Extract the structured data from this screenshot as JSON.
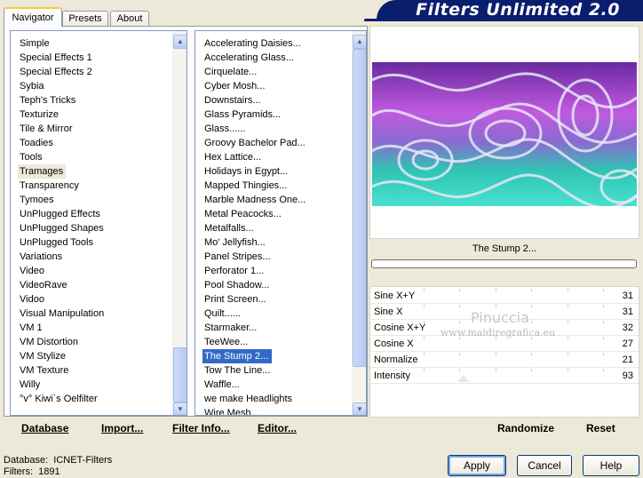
{
  "brand": {
    "title": "Filters Unlimited 2.0"
  },
  "tabs": [
    "Navigator",
    "Presets",
    "About"
  ],
  "categories": {
    "items": [
      "Simple",
      "Special Effects 1",
      "Special Effects 2",
      "Sybia",
      "Teph's Tricks",
      "Texturize",
      "Tile & Mirror",
      "Toadies",
      "Tools",
      "Tramages",
      "Transparency",
      "Tymoes",
      "UnPlugged Effects",
      "UnPlugged Shapes",
      "UnPlugged Tools",
      "Variations",
      "Video",
      "VideoRave",
      "Vidoo",
      "Visual Manipulation",
      "VM 1",
      "VM Distortion",
      "VM Stylize",
      "VM Texture",
      "Willy",
      "°v° Kiwi`s Oelfilter"
    ],
    "selected": "Tramages"
  },
  "filters": {
    "items": [
      "Accelerating Daisies...",
      "Accelerating Glass...",
      "Cirquelate...",
      "Cyber Mosh...",
      "Downstairs...",
      "Glass Pyramids...",
      "Glass......",
      "Groovy Bachelor Pad...",
      "Hex Lattice...",
      "Holidays in Egypt...",
      "Mapped Thingies...",
      "Marble Madness One...",
      "Metal Peacocks...",
      "Metalfalls...",
      "Mo' Jellyfish...",
      "Panel Stripes...",
      "Perforator 1...",
      "Pool Shadow...",
      "Print Screen...",
      "Quilt......",
      "Starmaker...",
      "TeeWee...",
      "The Stump 2...",
      "Tow The Line...",
      "Waffle...",
      "we make Headlights",
      "Wire Mesh..."
    ],
    "selected": "The Stump 2..."
  },
  "left_buttons": {
    "database": "Database",
    "import": "Import...",
    "filter_info": "Filter Info...",
    "editor": "Editor..."
  },
  "preview": {
    "filter_name": "The Stump 2...",
    "progress": 0
  },
  "params": [
    {
      "label": "Sine X+Y",
      "value": "31"
    },
    {
      "label": "Sine X",
      "value": "31"
    },
    {
      "label": "Cosine X+Y",
      "value": "32"
    },
    {
      "label": "Cosine X",
      "value": "27"
    },
    {
      "label": "Normalize",
      "value": "21"
    },
    {
      "label": "Intensity",
      "value": "93"
    }
  ],
  "watermark": {
    "line1": "Pinuccia",
    "line2": "www.maidiregrafica.eu"
  },
  "right_buttons": {
    "randomize": "Randomize",
    "reset": "Reset"
  },
  "footer": {
    "database_label": "Database:",
    "database_value": "ICNET-Filters",
    "filters_label": "Filters:",
    "filters_value": "1891",
    "apply": "Apply",
    "cancel": "Cancel",
    "help": "Help"
  },
  "colors": {
    "brand_bg": "#0a1e6e",
    "selection": "#316ac5",
    "preview_violet": "#b050d8",
    "preview_teal": "#2fc4b4"
  }
}
